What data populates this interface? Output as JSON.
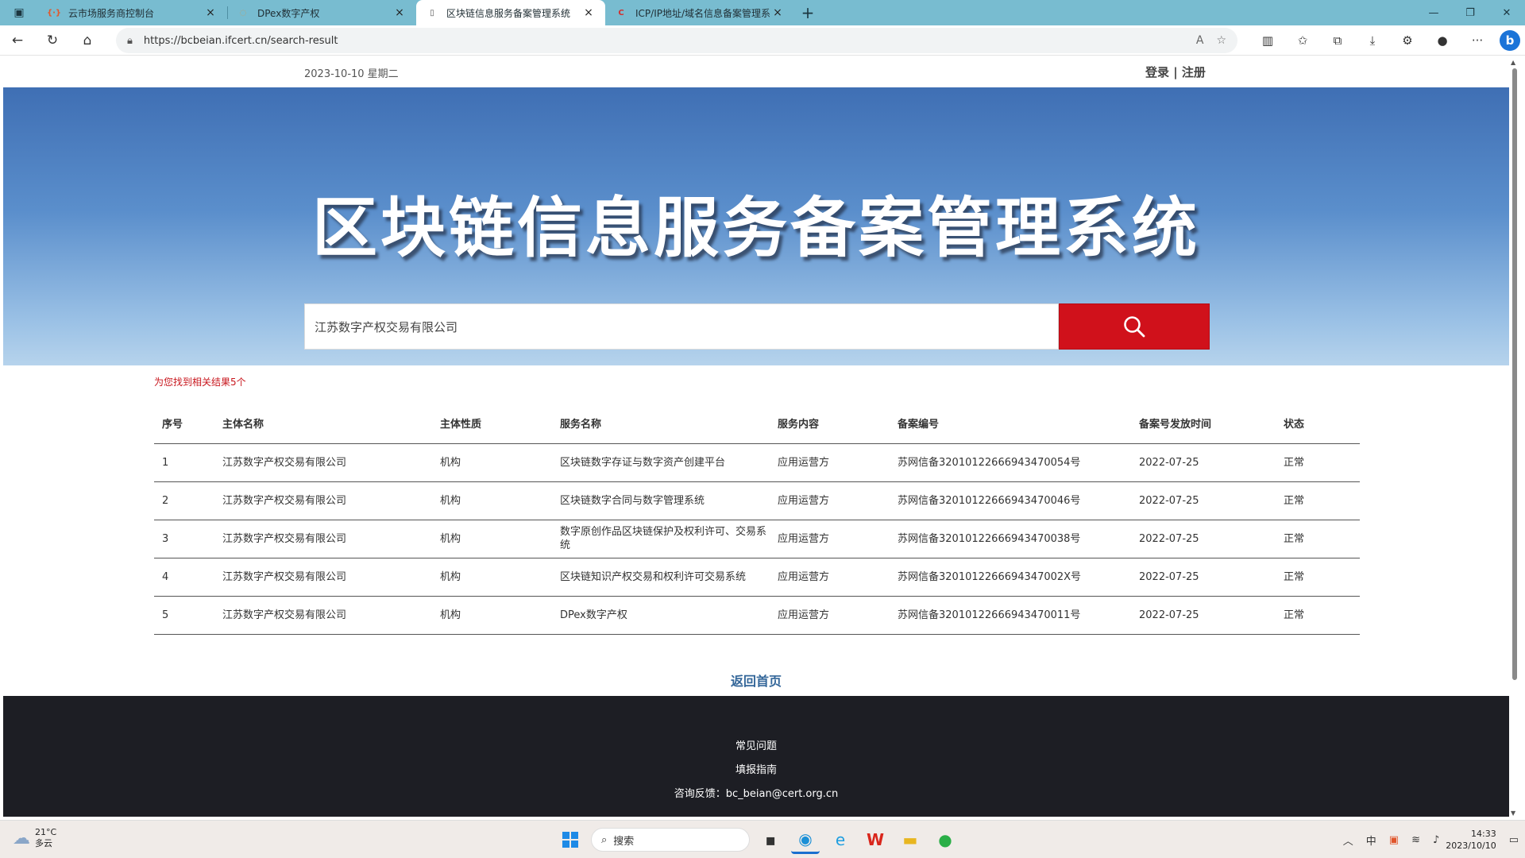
{
  "browser": {
    "tabs": [
      {
        "title": "云市场服务商控制台",
        "active": false,
        "fav": "{·}",
        "fav_color": "#e2572b"
      },
      {
        "title": "DPex数字产权",
        "active": false,
        "fav": "◌",
        "fav_color": "#b9a070"
      },
      {
        "title": "区块链信息服务备案管理系统",
        "active": true,
        "fav": "▯",
        "fav_color": "#555555"
      },
      {
        "title": "ICP/IP地址/域名信息备案管理系统",
        "active": false,
        "fav": "C",
        "fav_color": "#d32f2f"
      }
    ],
    "url": "https://bcbeian.ifcert.cn/search-result"
  },
  "page": {
    "date": "2023-10-10  星期二",
    "login": "登录 | 注册",
    "banner_title": "区块链信息服务备案管理系统",
    "search_value": "江苏数字产权交易有限公司",
    "result_count": "为您找到相关结果5个",
    "table": {
      "headers": [
        "序号",
        "主体名称",
        "主体性质",
        "服务名称",
        "服务内容",
        "备案编号",
        "备案号发放时间",
        "状态"
      ],
      "rows": [
        [
          "1",
          "江苏数字产权交易有限公司",
          "机构",
          "区块链数字存证与数字资产创建平台",
          "应用运营方",
          "苏网信备32010122666943470054号",
          "2022-07-25",
          "正常"
        ],
        [
          "2",
          "江苏数字产权交易有限公司",
          "机构",
          "区块链数字合同与数字管理系统",
          "应用运营方",
          "苏网信备32010122666943470046号",
          "2022-07-25",
          "正常"
        ],
        [
          "3",
          "江苏数字产权交易有限公司",
          "机构",
          "数字原创作品区块链保护及权利许可、交易系统",
          "应用运营方",
          "苏网信备32010122666943470038号",
          "2022-07-25",
          "正常"
        ],
        [
          "4",
          "江苏数字产权交易有限公司",
          "机构",
          "区块链知识产权交易和权利许可交易系统",
          "应用运营方",
          "苏网信备3201012266694347002X号",
          "2022-07-25",
          "正常"
        ],
        [
          "5",
          "江苏数字产权交易有限公司",
          "机构",
          "DPex数字产权",
          "应用运营方",
          "苏网信备32010122666943470011号",
          "2022-07-25",
          "正常"
        ]
      ]
    },
    "back_home": "返回首页",
    "footer": {
      "faq": "常见问题",
      "guide": "填报指南",
      "contact": "咨询反馈：bc_beian@cert.org.cn"
    }
  },
  "taskbar": {
    "weather_temp": "21°C",
    "weather_desc": "多云",
    "search_placeholder": "搜索",
    "time": "14:33",
    "date": "2023/10/10"
  },
  "colors": {
    "search_button": "#d0111b",
    "result_count": "#c8161d",
    "back_home": "#336699",
    "footer_bg": "#1d1e24"
  }
}
